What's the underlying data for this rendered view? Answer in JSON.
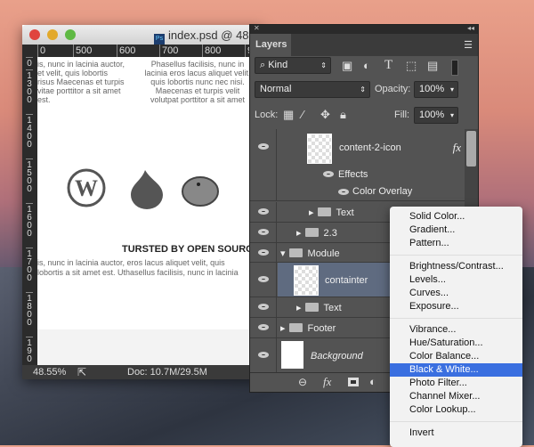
{
  "window": {
    "title": "index.psd @ 48",
    "zoom": "48.55%",
    "doc": "Doc: 10.7M/29.5M",
    "ruler_h": [
      "0",
      "500",
      "600",
      "700",
      "800",
      "9"
    ],
    "ruler_v": [
      "0",
      "1300",
      "1400",
      "1500",
      "1600",
      "1700",
      "1800",
      "190"
    ]
  },
  "canvas": {
    "col1": "is, nunc in lacinia auctor, et velit, quis lobortis risus Maecenas et turpis vitae porttitor a sit amet est.",
    "col2": "Phasellus facilisis, nunc in lacinia eros lacus aliquet velit, quis lobortis nunc nec nisi. Maecenas et turpis velit volutpat porttitor a sit amet",
    "heading": "TURSTED BY OPEN SOURCE",
    "para": "is, nunc in lacinia auctor, eros lacus aliquet velit, quis lobortis a sit amet est. Uthasellus facilisis, nunc in lacinia auctor, eros",
    "icons": [
      "wordpress-icon",
      "drupal-icon",
      "duck-icon"
    ]
  },
  "panel": {
    "tab": "Layers",
    "kind": "Kind",
    "blend": "Normal",
    "opacity_label": "Opacity:",
    "opacity": "100%",
    "lock_label": "Lock:",
    "fill_label": "Fill:",
    "fill": "100%",
    "layers": [
      {
        "name": "content-2-icon",
        "fx": "fx"
      },
      {
        "name": "Effects"
      },
      {
        "name": "Color Overlay"
      },
      {
        "name": "Text"
      },
      {
        "name": "2.3"
      },
      {
        "name": "Module"
      },
      {
        "name": "containter"
      },
      {
        "name": "Text"
      },
      {
        "name": "Footer"
      },
      {
        "name": "Background"
      }
    ],
    "fx_label": "fx"
  },
  "menu": {
    "groups": [
      [
        "Solid Color...",
        "Gradient...",
        "Pattern..."
      ],
      [
        "Brightness/Contrast...",
        "Levels...",
        "Curves...",
        "Exposure..."
      ],
      [
        "Vibrance...",
        "Hue/Saturation...",
        "Color Balance...",
        "Black & White...",
        "Photo Filter...",
        "Channel Mixer...",
        "Color Lookup..."
      ],
      [
        "Invert"
      ]
    ],
    "selected": "Black & White..."
  },
  "colors": {
    "selection": "#3a6fe0",
    "panel": "#535353"
  }
}
